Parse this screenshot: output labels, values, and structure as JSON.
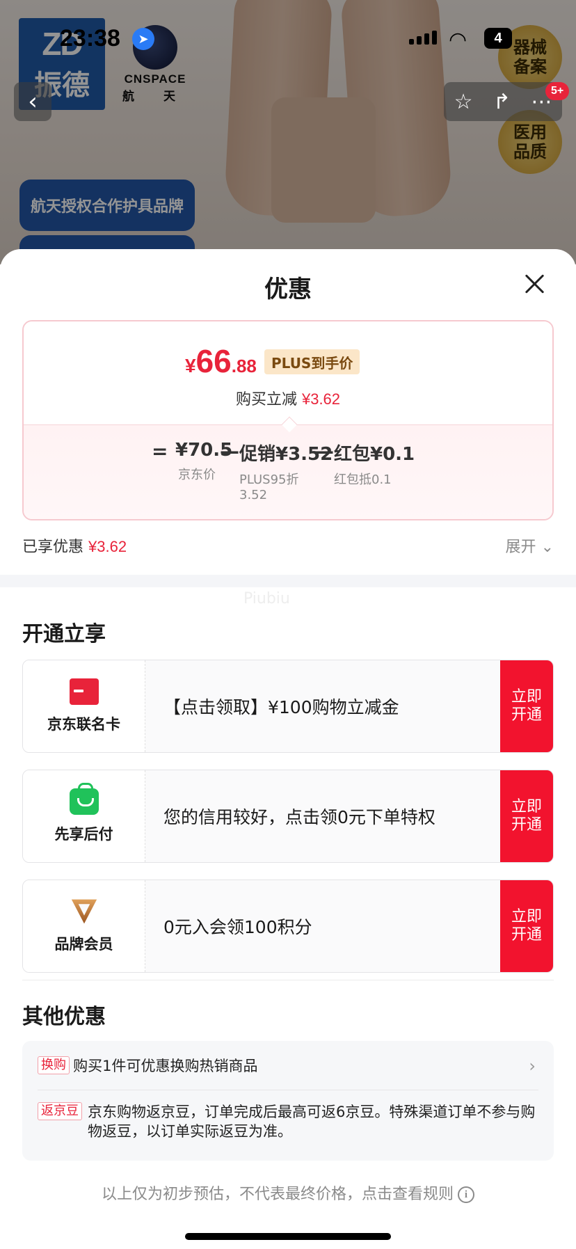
{
  "status_bar": {
    "time": "23:38",
    "battery": "4"
  },
  "product_bg": {
    "brand_logo_latin": "ZD",
    "brand_logo_cn": "振德",
    "partner_logo_latin": "CNSPACE",
    "partner_logo_cn": "航 天",
    "badge_1": "航天授权合作护具品牌",
    "medal_1": "器械备案",
    "medal_2": "医用品质",
    "message_count": "5+"
  },
  "sheet": {
    "title": "优惠",
    "price": {
      "currency": "¥",
      "integer": "66",
      "decimal": ".88",
      "plus_tag": "PLUS到手价",
      "instant_off_label": "购买立减",
      "instant_off_value": "¥3.62"
    },
    "formula": {
      "equals": "=",
      "minus": "—",
      "items": [
        {
          "value": "¥70.5",
          "label": "京东价",
          "label2": ""
        },
        {
          "value": "促销¥3.52",
          "label": "PLUS95折",
          "label2": "3.52"
        },
        {
          "value": "红包¥0.1",
          "label": "红包抵0.1",
          "label2": ""
        }
      ]
    },
    "enjoyed_label": "已享优惠",
    "enjoyed_value": "¥3.62",
    "expand_label": "展开",
    "watermark": "Piubiu",
    "open_section_title": "开通立享",
    "offers": [
      {
        "name": "京东联名卡",
        "icon": "card-icon",
        "text": "【点击领取】¥100购物立减金",
        "button": "立即开通"
      },
      {
        "name": "先享后付",
        "icon": "shopping-bag-icon",
        "text": "您的信用较好，点击领0元下单特权",
        "button": "立即开通"
      },
      {
        "name": "品牌会员",
        "icon": "brand-v-icon",
        "text": "0元入会领100积分",
        "button": "立即开通"
      }
    ],
    "other_section_title": "其他优惠",
    "other_offers": [
      {
        "tag": "换购",
        "text": "购买1件可优惠换购热销商品"
      },
      {
        "tag": "返京豆",
        "text": "京东购物返京豆，订单完成后最高可返6京豆。特殊渠道订单不参与购物返豆，以订单实际返豆为准。"
      }
    ],
    "footer_note": "以上仅为初步预估，不代表最终价格，点击查看规则",
    "colors": {
      "accent_red": "#e8233a",
      "button_red": "#f2132e",
      "green": "#20c25a",
      "plus_tag_bg": "#fbe6c8"
    }
  }
}
